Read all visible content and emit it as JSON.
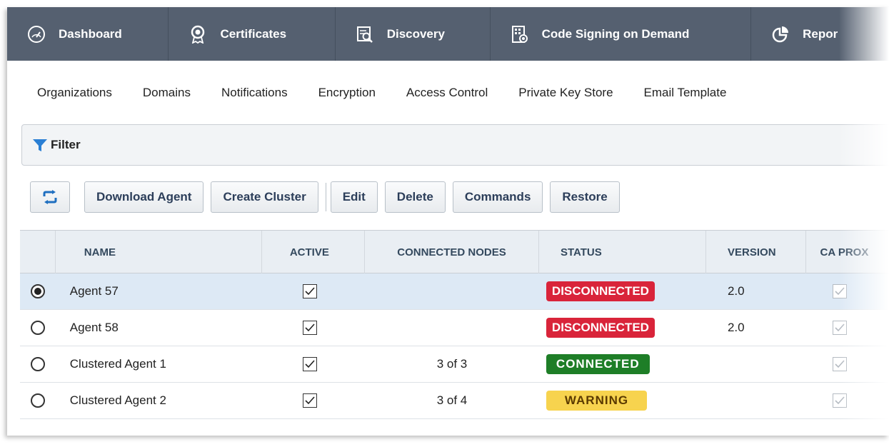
{
  "topnav": {
    "tabs": [
      {
        "label": "Dashboard",
        "icon": "gauge-icon"
      },
      {
        "label": "Certificates",
        "icon": "certificate-badge-icon"
      },
      {
        "label": "Discovery",
        "icon": "discovery-search-icon"
      },
      {
        "label": "Code Signing on Demand",
        "icon": "code-signing-icon"
      },
      {
        "label": "Repor",
        "icon": "report-chart-icon"
      }
    ]
  },
  "subnav": {
    "items": [
      "Organizations",
      "Domains",
      "Notifications",
      "Encryption",
      "Access Control",
      "Private Key Store",
      "Email Template"
    ]
  },
  "filter": {
    "label": "Filter"
  },
  "toolbar": {
    "download_agent": "Download Agent",
    "create_cluster": "Create Cluster",
    "edit": "Edit",
    "delete": "Delete",
    "commands": "Commands",
    "restore": "Restore"
  },
  "table": {
    "headers": [
      "NAME",
      "ACTIVE",
      "CONNECTED NODES",
      "STATUS",
      "VERSION",
      "CA PROX"
    ],
    "rows": [
      {
        "name": "Agent 57",
        "active": true,
        "nodes": "",
        "status": "DISCONNECTED",
        "version": "2.0",
        "selected": true
      },
      {
        "name": "Agent 58",
        "active": true,
        "nodes": "",
        "status": "DISCONNECTED",
        "version": "2.0",
        "selected": false
      },
      {
        "name": "Clustered Agent 1",
        "active": true,
        "nodes": "3 of 3",
        "status": "CONNECTED",
        "version": "",
        "selected": false
      },
      {
        "name": "Clustered Agent 2",
        "active": true,
        "nodes": "3 of 4",
        "status": "WARNING",
        "version": "",
        "selected": false
      }
    ]
  },
  "colors": {
    "nav_bg": "#556070",
    "disconnected": "#d9243a",
    "connected": "#1e7e27",
    "warning": "#f7d34e",
    "selected_row": "#dde9f5"
  }
}
